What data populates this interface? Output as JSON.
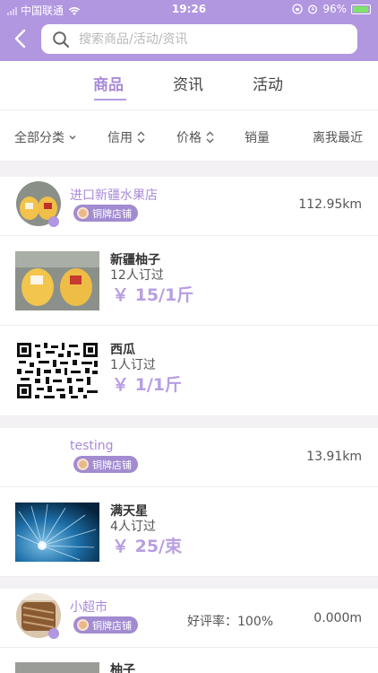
{
  "status_bar": {
    "carrier": "中国联通",
    "time": "19:26",
    "battery": "96%"
  },
  "search": {
    "placeholder": "搜索商品/活动/资讯"
  },
  "tabs": [
    {
      "label": "商品",
      "active": true
    },
    {
      "label": "资讯",
      "active": false
    },
    {
      "label": "活动",
      "active": false
    }
  ],
  "filters": {
    "category": "全部分类",
    "credit": "信用",
    "price": "价格",
    "sales": "销量",
    "nearest": "离我最近"
  },
  "shops": [
    {
      "name": "进口新疆水果店",
      "badge": "铜牌店铺",
      "distance": "112.95km",
      "products": [
        {
          "name": "新疆柚子",
          "orders": "12人订过",
          "price": "￥ 15/1斤"
        },
        {
          "name": "西瓜",
          "orders": "1人订过",
          "price": "￥ 1/1斤"
        }
      ]
    },
    {
      "name": "testing",
      "badge": "铜牌店铺",
      "distance": "13.91km",
      "products": [
        {
          "name": "满天星",
          "orders": "4人订过",
          "price": "￥ 25/束"
        }
      ]
    },
    {
      "name": "小超市",
      "badge": "铜牌店铺",
      "rating": "好评率：100%",
      "distance": "0.000m",
      "products": [
        {
          "name": "柚子"
        }
      ]
    }
  ],
  "colors": {
    "brand": "#b196e0",
    "accent_text": "#a98ad9",
    "price": "#b89ee2"
  }
}
